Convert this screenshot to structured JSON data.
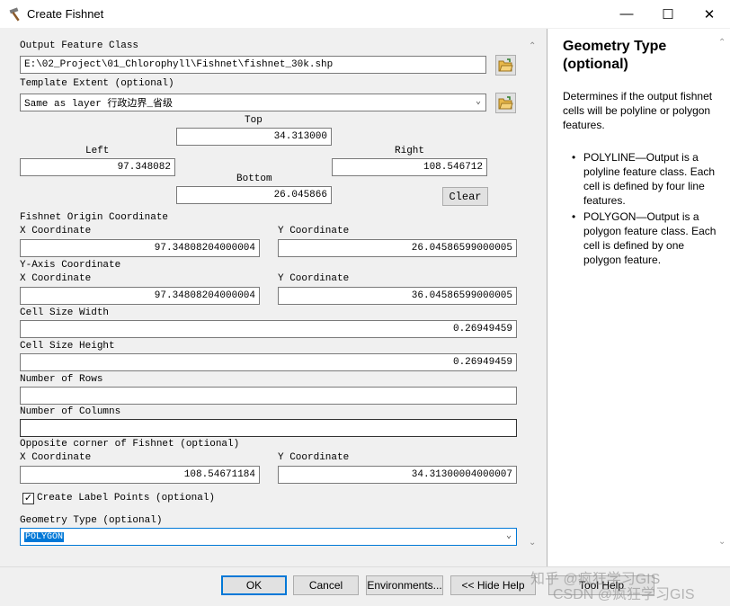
{
  "window": {
    "title": "Create Fishnet",
    "minimize": "—",
    "maximize": "☐",
    "close": "✕"
  },
  "output_feature_class": {
    "label": "Output Feature Class",
    "value": "E:\\02_Project\\01_Chlorophyll\\Fishnet\\fishnet_30k.shp"
  },
  "template_extent": {
    "label": "Template Extent (optional)",
    "value": "Same as layer 行政边界_省级",
    "top_label": "Top",
    "top_value": "34.313000",
    "left_label": "Left",
    "left_value": "97.348082",
    "right_label": "Right",
    "right_value": "108.546712",
    "bottom_label": "Bottom",
    "bottom_value": "26.045866",
    "clear_label": "Clear"
  },
  "origin": {
    "label": "Fishnet Origin Coordinate",
    "x_label": "X Coordinate",
    "x_value": "97.34808204000004",
    "y_label": "Y Coordinate",
    "y_value": "26.04586599000005"
  },
  "yaxis": {
    "label": "Y-Axis Coordinate",
    "x_label": "X Coordinate",
    "x_value": "97.34808204000004",
    "y_label": "Y Coordinate",
    "y_value": "36.04586599000005"
  },
  "cell_width": {
    "label": "Cell Size Width",
    "value": "0.26949459"
  },
  "cell_height": {
    "label": "Cell Size Height",
    "value": "0.26949459"
  },
  "rows": {
    "label": "Number of Rows",
    "value": ""
  },
  "columns": {
    "label": "Number of Columns",
    "value": ""
  },
  "opposite": {
    "label": "Opposite corner of Fishnet (optional)",
    "x_label": "X Coordinate",
    "x_value": "108.54671184",
    "y_label": "Y Coordinate",
    "y_value": "34.31300004000007"
  },
  "label_points": {
    "label": "Create Label Points (optional)",
    "checked": "✓"
  },
  "geometry_type": {
    "label": "Geometry Type (optional)",
    "value": "POLYGON"
  },
  "help": {
    "title": "Geometry Type (optional)",
    "description": "Determines if the output fishnet cells will be polyline or polygon features.",
    "items": [
      "POLYLINE—Output is a polyline feature class. Each cell is defined by four line features.",
      "POLYGON—Output is a polygon feature class. Each cell is defined by one polygon feature."
    ]
  },
  "buttons": {
    "ok": "OK",
    "cancel": "Cancel",
    "environments": "Environments...",
    "hide_help": "<< Hide Help",
    "tool_help": "Tool Help"
  },
  "watermark": {
    "line1": "知乎 @疯狂学习GIS",
    "line2": "CSDN @疯狂学习GIS"
  },
  "colors": {
    "selection": "#0078d7",
    "accent_border": "#0078d7"
  },
  "icons": [
    "hammer-icon",
    "folder-open-icon",
    "chevron-down-icon"
  ]
}
